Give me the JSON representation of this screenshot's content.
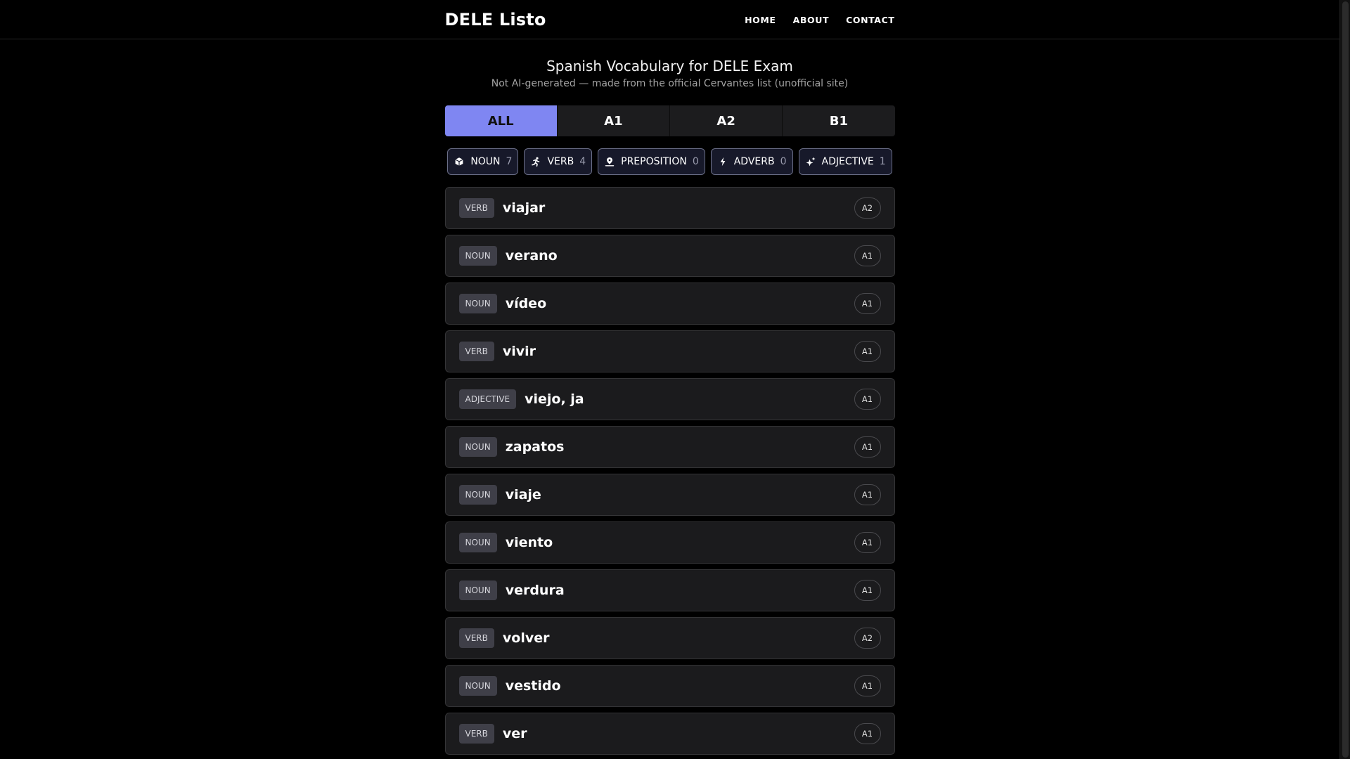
{
  "header": {
    "brand": "DELE Listo",
    "nav": [
      "HOME",
      "ABOUT",
      "CONTACT"
    ]
  },
  "intro": {
    "title": "Spanish Vocabulary for DELE Exam",
    "subtitle": "Not AI-generated — made from the official Cervantes list (unofficial site)"
  },
  "level_tabs": {
    "items": [
      "ALL",
      "A1",
      "A2",
      "B1"
    ],
    "active": "ALL",
    "active_color": "#7f86f2"
  },
  "type_filters": [
    {
      "label": "NOUN",
      "count": "7",
      "icon": "cube-icon"
    },
    {
      "label": "VERB",
      "count": "4",
      "icon": "running-person-icon"
    },
    {
      "label": "PREPOSITION",
      "count": "0",
      "icon": "map-pin-icon"
    },
    {
      "label": "ADVERB",
      "count": "0",
      "icon": "lightning-icon"
    },
    {
      "label": "ADJECTIVE",
      "count": "1",
      "icon": "sparkles-icon"
    }
  ],
  "words": [
    {
      "type": "VERB",
      "word": "viajar",
      "level": "A2"
    },
    {
      "type": "NOUN",
      "word": "verano",
      "level": "A1"
    },
    {
      "type": "NOUN",
      "word": "vídeo",
      "level": "A1"
    },
    {
      "type": "VERB",
      "word": "vivir",
      "level": "A1"
    },
    {
      "type": "ADJECTIVE",
      "word": "viejo, ja",
      "level": "A1"
    },
    {
      "type": "NOUN",
      "word": "zapatos",
      "level": "A1"
    },
    {
      "type": "NOUN",
      "word": "viaje",
      "level": "A1"
    },
    {
      "type": "NOUN",
      "word": "viento",
      "level": "A1"
    },
    {
      "type": "NOUN",
      "word": "verdura",
      "level": "A1"
    },
    {
      "type": "VERB",
      "word": "volver",
      "level": "A2"
    },
    {
      "type": "NOUN",
      "word": "vestido",
      "level": "A1"
    },
    {
      "type": "VERB",
      "word": "ver",
      "level": "A1"
    }
  ]
}
